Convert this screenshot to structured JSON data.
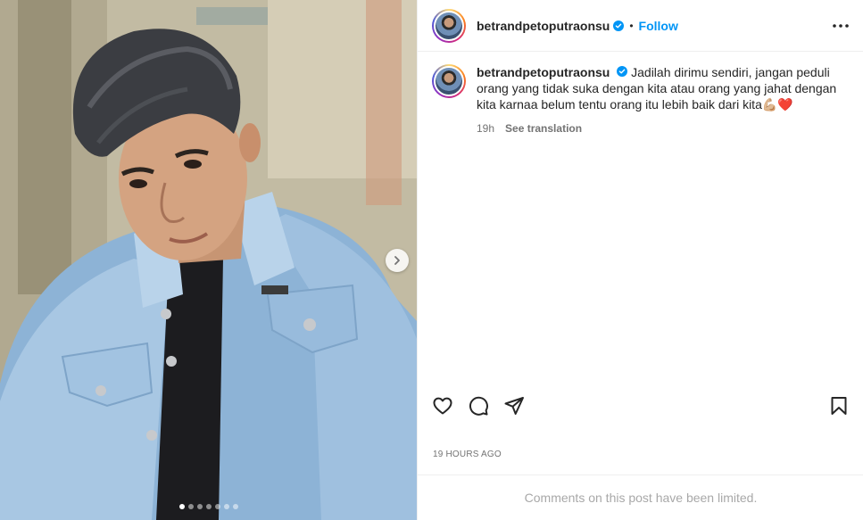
{
  "media": {
    "carousel_dots": 7,
    "active_dot": 0
  },
  "post": {
    "username": "betrandpetoputraonsu",
    "follow_label": "Follow",
    "separator": "•",
    "caption_text": "Jadilah dirimu sendiri, jangan peduli orang yang tidak suka dengan kita atau orang yang jahat dengan kita karnaa belum tentu orang itu lebih baik dari kita",
    "caption_emojis": "💪🏼❤️",
    "relative_time": "19h",
    "see_translation": "See translation",
    "timestamp": "19 HOURS AGO",
    "comments_limited": "Comments on this post have been limited."
  },
  "colors": {
    "accent": "#0095f6",
    "verified": "#0095f6",
    "text_primary": "#262626",
    "text_secondary": "#737373",
    "text_muted": "#a8a8a8"
  },
  "icons": {
    "like": "heart-icon",
    "comment": "comment-icon",
    "share": "share-icon",
    "save": "bookmark-icon",
    "more": "more-icon",
    "next": "chevron-right-icon"
  }
}
